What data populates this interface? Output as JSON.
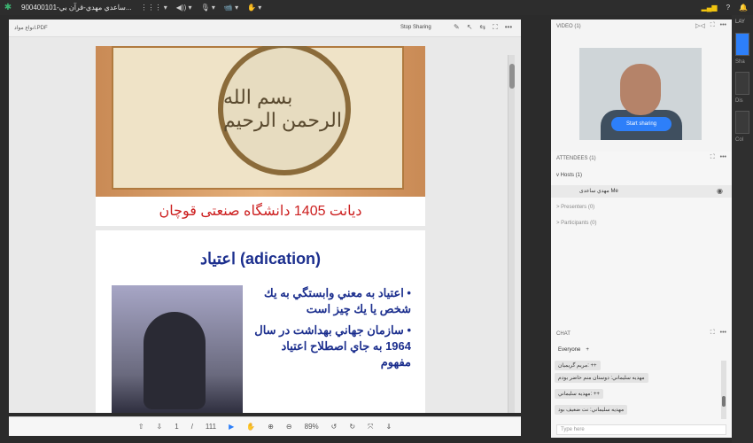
{
  "topbar": {
    "title": "900400101-ساعدي مهدي-قرآن بي...",
    "items": [
      {
        "label": "⋮⋮⋮ ▾"
      },
      {
        "label": "◀)) ▾"
      },
      {
        "label": "🎙 ▾"
      },
      {
        "label": "📹 ▾"
      },
      {
        "label": "✋ ▾"
      }
    ]
  },
  "share": {
    "filename": "انواع مواد.PDF",
    "stop_label": "Stop Sharing"
  },
  "slide1": {
    "caption": "ديانت 1405 دانشگاه صنعتی قوچان",
    "calligraphy": "بسم الله الرحمن الرحيم"
  },
  "slide2": {
    "heading": "اعتياد (adication)",
    "bullet1": "• اعتياد به معني وابستگي به يك شخص يا يك چيز است",
    "bullet2": "• سازمان جهاني بهداشت در سال 1964 به جاي اصطلاح اعتياد مفهوم"
  },
  "toolbar_bottom": {
    "page": "1",
    "sep": "/",
    "total": "111",
    "zoom": "89%"
  },
  "video": {
    "header": "VIDEO (1)",
    "start_label": "Start sharing"
  },
  "attendees": {
    "header": "ATTENDEES (1)",
    "hosts": "Hosts (1)",
    "host_name": "مهدي ساعدی Me",
    "presenters": "Presenters (0)",
    "participants": "Participants (0)"
  },
  "chat": {
    "header": "CHAT",
    "tab": "Everyone",
    "messages": [
      {
        "text": "مريم گريميان: ++"
      },
      {
        "text": "مهديه سليماني: دوستان منم حاضر بودم"
      },
      {
        "text": "مهديه سليماني: ++"
      },
      {
        "text": "مهديه سليماني: نت ضعيف بود"
      }
    ],
    "placeholder": "Type here"
  },
  "farRight": {
    "lay": "LAY",
    "sha": "Sha",
    "dis": "Dis",
    "col": "Col"
  }
}
